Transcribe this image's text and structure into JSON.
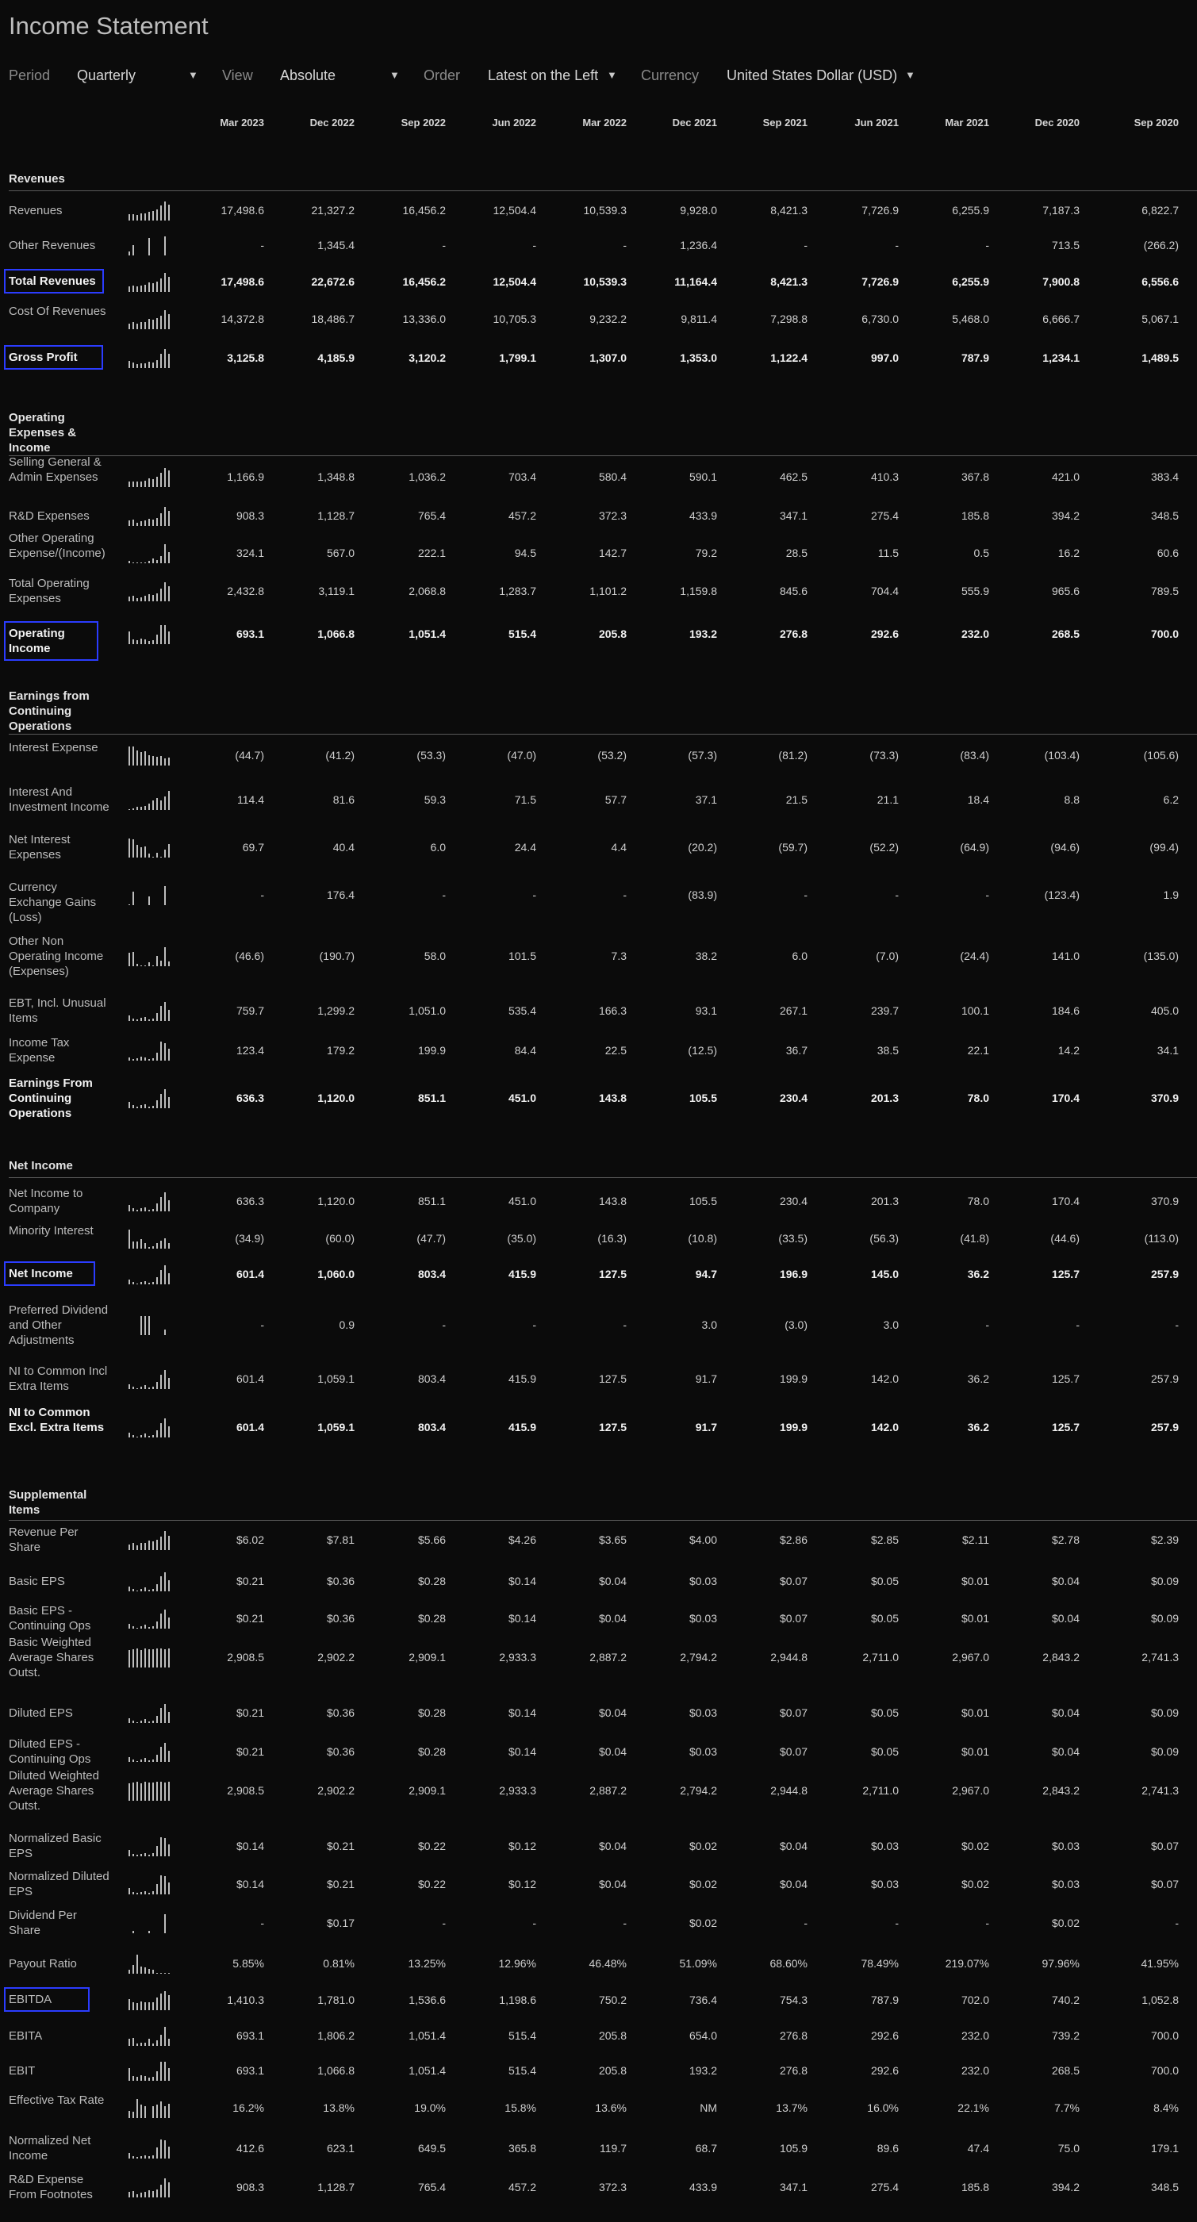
{
  "page_title": "Income Statement",
  "controls": {
    "period_label": "Period",
    "period_value": "Quarterly",
    "view_label": "View",
    "view_value": "Absolute",
    "order_label": "Order",
    "order_value": "Latest on the Left",
    "currency_label": "Currency",
    "currency_value": "United States Dollar (USD)",
    "caret": "▼"
  },
  "columns": [
    "Mar 2023",
    "Dec 2022",
    "Sep 2022",
    "Jun 2022",
    "Mar 2022",
    "Dec 2021",
    "Sep 2021",
    "Jun 2021",
    "Mar 2021",
    "Dec 2020",
    "Sep 2020"
  ],
  "sections": [
    {
      "title": "Revenues",
      "rows": [
        {
          "label": "Revenues",
          "values": [
            "17,498.6",
            "21,327.2",
            "16,456.2",
            "12,504.4",
            "10,539.3",
            "9,928.0",
            "8,421.3",
            "7,726.9",
            "6,255.9",
            "7,187.3",
            "6,822.7"
          ]
        },
        {
          "label": "Other Revenues",
          "values": [
            "-",
            "1,345.4",
            "-",
            "-",
            "-",
            "1,236.4",
            "-",
            "-",
            "-",
            "713.5",
            "(266.2)"
          ]
        },
        {
          "label": "Total Revenues",
          "bold": true,
          "highlight": true,
          "values": [
            "17,498.6",
            "22,672.6",
            "16,456.2",
            "12,504.4",
            "10,539.3",
            "11,164.4",
            "8,421.3",
            "7,726.9",
            "6,255.9",
            "7,900.8",
            "6,556.6"
          ]
        },
        {
          "label": "Cost Of Revenues",
          "values": [
            "14,372.8",
            "18,486.7",
            "13,336.0",
            "10,705.3",
            "9,232.2",
            "9,811.4",
            "7,298.8",
            "6,730.0",
            "5,468.0",
            "6,666.7",
            "5,067.1"
          ]
        },
        {
          "label": "Gross Profit",
          "bold": true,
          "highlight": true,
          "values": [
            "3,125.8",
            "4,185.9",
            "3,120.2",
            "1,799.1",
            "1,307.0",
            "1,353.0",
            "1,122.4",
            "997.0",
            "787.9",
            "1,234.1",
            "1,489.5"
          ]
        }
      ]
    },
    {
      "title": "Operating Expenses & Income",
      "rows": [
        {
          "label": "Selling General & Admin Expenses",
          "values": [
            "1,166.9",
            "1,348.8",
            "1,036.2",
            "703.4",
            "580.4",
            "590.1",
            "462.5",
            "410.3",
            "367.8",
            "421.0",
            "383.4"
          ]
        },
        {
          "label": "R&D Expenses",
          "values": [
            "908.3",
            "1,128.7",
            "765.4",
            "457.2",
            "372.3",
            "433.9",
            "347.1",
            "275.4",
            "185.8",
            "394.2",
            "348.5"
          ]
        },
        {
          "label": "Other Operating Expense/(Income)",
          "values": [
            "324.1",
            "567.0",
            "222.1",
            "94.5",
            "142.7",
            "79.2",
            "28.5",
            "11.5",
            "0.5",
            "16.2",
            "60.6"
          ]
        },
        {
          "label": "Total Operating Expenses",
          "values": [
            "2,432.8",
            "3,119.1",
            "2,068.8",
            "1,283.7",
            "1,101.2",
            "1,159.8",
            "845.6",
            "704.4",
            "555.9",
            "965.6",
            "789.5"
          ]
        },
        {
          "label": "Operating Income",
          "bold": true,
          "highlight": true,
          "values": [
            "693.1",
            "1,066.8",
            "1,051.4",
            "515.4",
            "205.8",
            "193.2",
            "276.8",
            "292.6",
            "232.0",
            "268.5",
            "700.0"
          ]
        }
      ]
    },
    {
      "title": "Earnings from Continuing Operations",
      "rows": [
        {
          "label": "Interest Expense",
          "values": [
            "(44.7)",
            "(41.2)",
            "(53.3)",
            "(47.0)",
            "(53.2)",
            "(57.3)",
            "(81.2)",
            "(73.3)",
            "(83.4)",
            "(103.4)",
            "(105.6)"
          ]
        },
        {
          "label": "Interest And Investment Income",
          "values": [
            "114.4",
            "81.6",
            "59.3",
            "71.5",
            "57.7",
            "37.1",
            "21.5",
            "21.1",
            "18.4",
            "8.8",
            "6.2"
          ]
        },
        {
          "label": "Net Interest Expenses",
          "values": [
            "69.7",
            "40.4",
            "6.0",
            "24.4",
            "4.4",
            "(20.2)",
            "(59.7)",
            "(52.2)",
            "(64.9)",
            "(94.6)",
            "(99.4)"
          ]
        },
        {
          "label": "Currency Exchange Gains (Loss)",
          "values": [
            "-",
            "176.4",
            "-",
            "-",
            "-",
            "(83.9)",
            "-",
            "-",
            "-",
            "(123.4)",
            "1.9"
          ]
        },
        {
          "label": "Other Non Operating Income (Expenses)",
          "values": [
            "(46.6)",
            "(190.7)",
            "58.0",
            "101.5",
            "7.3",
            "38.2",
            "6.0",
            "(7.0)",
            "(24.4)",
            "141.0",
            "(135.0)"
          ]
        },
        {
          "label": "EBT, Incl. Unusual Items",
          "values": [
            "759.7",
            "1,299.2",
            "1,051.0",
            "535.4",
            "166.3",
            "93.1",
            "267.1",
            "239.7",
            "100.1",
            "184.6",
            "405.0"
          ]
        },
        {
          "label": "Income Tax Expense",
          "values": [
            "123.4",
            "179.2",
            "199.9",
            "84.4",
            "22.5",
            "(12.5)",
            "36.7",
            "38.5",
            "22.1",
            "14.2",
            "34.1"
          ]
        },
        {
          "label": "Earnings From Continuing Operations",
          "bold": true,
          "values": [
            "636.3",
            "1,120.0",
            "851.1",
            "451.0",
            "143.8",
            "105.5",
            "230.4",
            "201.3",
            "78.0",
            "170.4",
            "370.9"
          ]
        }
      ]
    },
    {
      "title": "Net Income",
      "rows": [
        {
          "label": "Net Income to Company",
          "values": [
            "636.3",
            "1,120.0",
            "851.1",
            "451.0",
            "143.8",
            "105.5",
            "230.4",
            "201.3",
            "78.0",
            "170.4",
            "370.9"
          ]
        },
        {
          "label": "Minority Interest",
          "values": [
            "(34.9)",
            "(60.0)",
            "(47.7)",
            "(35.0)",
            "(16.3)",
            "(10.8)",
            "(33.5)",
            "(56.3)",
            "(41.8)",
            "(44.6)",
            "(113.0)"
          ]
        },
        {
          "label": "Net Income",
          "bold": true,
          "highlight": true,
          "values": [
            "601.4",
            "1,060.0",
            "803.4",
            "415.9",
            "127.5",
            "94.7",
            "196.9",
            "145.0",
            "36.2",
            "125.7",
            "257.9"
          ]
        },
        {
          "label": "Preferred Dividend and Other Adjustments",
          "values": [
            "-",
            "0.9",
            "-",
            "-",
            "-",
            "3.0",
            "(3.0)",
            "3.0",
            "-",
            "-",
            "-"
          ]
        },
        {
          "label": "NI to Common Incl Extra Items",
          "values": [
            "601.4",
            "1,059.1",
            "803.4",
            "415.9",
            "127.5",
            "91.7",
            "199.9",
            "142.0",
            "36.2",
            "125.7",
            "257.9"
          ]
        },
        {
          "label": "NI to Common Excl. Extra Items",
          "bold": true,
          "values": [
            "601.4",
            "1,059.1",
            "803.4",
            "415.9",
            "127.5",
            "91.7",
            "199.9",
            "142.0",
            "36.2",
            "125.7",
            "257.9"
          ]
        }
      ]
    },
    {
      "title": "Supplemental Items",
      "rows": [
        {
          "label": "Revenue Per Share",
          "values": [
            "$6.02",
            "$7.81",
            "$5.66",
            "$4.26",
            "$3.65",
            "$4.00",
            "$2.86",
            "$2.85",
            "$2.11",
            "$2.78",
            "$2.39"
          ]
        },
        {
          "label": "Basic EPS",
          "values": [
            "$0.21",
            "$0.36",
            "$0.28",
            "$0.14",
            "$0.04",
            "$0.03",
            "$0.07",
            "$0.05",
            "$0.01",
            "$0.04",
            "$0.09"
          ]
        },
        {
          "label": "Basic EPS - Continuing Ops",
          "values": [
            "$0.21",
            "$0.36",
            "$0.28",
            "$0.14",
            "$0.04",
            "$0.03",
            "$0.07",
            "$0.05",
            "$0.01",
            "$0.04",
            "$0.09"
          ]
        },
        {
          "label": "Basic Weighted Average Shares Outst.",
          "values": [
            "2,908.5",
            "2,902.2",
            "2,909.1",
            "2,933.3",
            "2,887.2",
            "2,794.2",
            "2,944.8",
            "2,711.0",
            "2,967.0",
            "2,843.2",
            "2,741.3"
          ]
        },
        {
          "label": "Diluted EPS",
          "values": [
            "$0.21",
            "$0.36",
            "$0.28",
            "$0.14",
            "$0.04",
            "$0.03",
            "$0.07",
            "$0.05",
            "$0.01",
            "$0.04",
            "$0.09"
          ]
        },
        {
          "label": "Diluted EPS - Continuing Ops",
          "values": [
            "$0.21",
            "$0.36",
            "$0.28",
            "$0.14",
            "$0.04",
            "$0.03",
            "$0.07",
            "$0.05",
            "$0.01",
            "$0.04",
            "$0.09"
          ]
        },
        {
          "label": "Diluted Weighted Average Shares Outst.",
          "values": [
            "2,908.5",
            "2,902.2",
            "2,909.1",
            "2,933.3",
            "2,887.2",
            "2,794.2",
            "2,944.8",
            "2,711.0",
            "2,967.0",
            "2,843.2",
            "2,741.3"
          ]
        },
        {
          "label": "Normalized Basic EPS",
          "values": [
            "$0.14",
            "$0.21",
            "$0.22",
            "$0.12",
            "$0.04",
            "$0.02",
            "$0.04",
            "$0.03",
            "$0.02",
            "$0.03",
            "$0.07"
          ]
        },
        {
          "label": "Normalized Diluted EPS",
          "values": [
            "$0.14",
            "$0.21",
            "$0.22",
            "$0.12",
            "$0.04",
            "$0.02",
            "$0.04",
            "$0.03",
            "$0.02",
            "$0.03",
            "$0.07"
          ]
        },
        {
          "label": "Dividend Per Share",
          "values": [
            "-",
            "$0.17",
            "-",
            "-",
            "-",
            "$0.02",
            "-",
            "-",
            "-",
            "$0.02",
            "-"
          ]
        },
        {
          "label": "Payout Ratio",
          "values": [
            "5.85%",
            "0.81%",
            "13.25%",
            "12.96%",
            "46.48%",
            "51.09%",
            "68.60%",
            "78.49%",
            "219.07%",
            "97.96%",
            "41.95%"
          ]
        },
        {
          "label": "EBITDA",
          "highlight": true,
          "values": [
            "1,410.3",
            "1,781.0",
            "1,536.6",
            "1,198.6",
            "750.2",
            "736.4",
            "754.3",
            "787.9",
            "702.0",
            "740.2",
            "1,052.8"
          ]
        },
        {
          "label": "EBITA",
          "values": [
            "693.1",
            "1,806.2",
            "1,051.4",
            "515.4",
            "205.8",
            "654.0",
            "276.8",
            "292.6",
            "232.0",
            "739.2",
            "700.0"
          ]
        },
        {
          "label": "EBIT",
          "values": [
            "693.1",
            "1,066.8",
            "1,051.4",
            "515.4",
            "205.8",
            "193.2",
            "276.8",
            "292.6",
            "232.0",
            "268.5",
            "700.0"
          ]
        },
        {
          "label": "Effective Tax Rate",
          "values": [
            "16.2%",
            "13.8%",
            "19.0%",
            "15.8%",
            "13.6%",
            "NM",
            "13.7%",
            "16.0%",
            "22.1%",
            "7.7%",
            "8.4%"
          ]
        },
        {
          "label": "Normalized Net Income",
          "values": [
            "412.6",
            "623.1",
            "649.5",
            "365.8",
            "119.7",
            "68.7",
            "105.9",
            "89.6",
            "47.4",
            "75.0",
            "179.1"
          ]
        },
        {
          "label": "R&D Expense From Footnotes",
          "values": [
            "908.3",
            "1,128.7",
            "765.4",
            "457.2",
            "372.3",
            "433.9",
            "347.1",
            "275.4",
            "185.8",
            "394.2",
            "348.5"
          ]
        }
      ]
    }
  ]
}
